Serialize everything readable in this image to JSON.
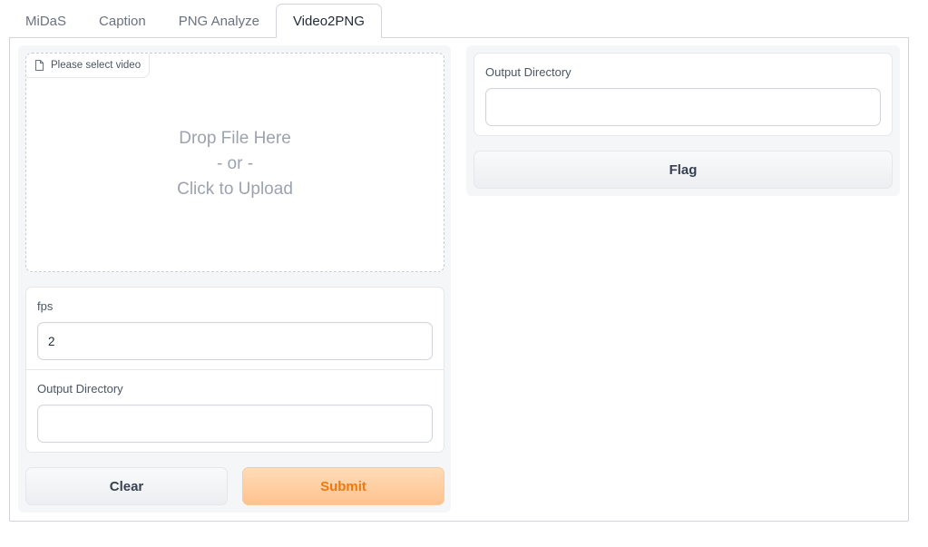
{
  "tabs": [
    {
      "label": "MiDaS",
      "active": false
    },
    {
      "label": "Caption",
      "active": false
    },
    {
      "label": "PNG Analyze",
      "active": false
    },
    {
      "label": "Video2PNG",
      "active": true
    }
  ],
  "video_input": {
    "label": "Please select video",
    "icon": "file-icon",
    "drop_line1": "Drop File Here",
    "drop_line2": "- or -",
    "drop_line3": "Click to Upload"
  },
  "fps": {
    "label": "fps",
    "value": "2"
  },
  "output_directory_input": {
    "label": "Output Directory",
    "value": ""
  },
  "buttons": {
    "clear": "Clear",
    "submit": "Submit",
    "flag": "Flag"
  },
  "output": {
    "label": "Output Directory",
    "value": ""
  },
  "colors": {
    "accent": "#ea7a12",
    "primary_bg": "#ffc28e",
    "border": "#d1d5db"
  }
}
